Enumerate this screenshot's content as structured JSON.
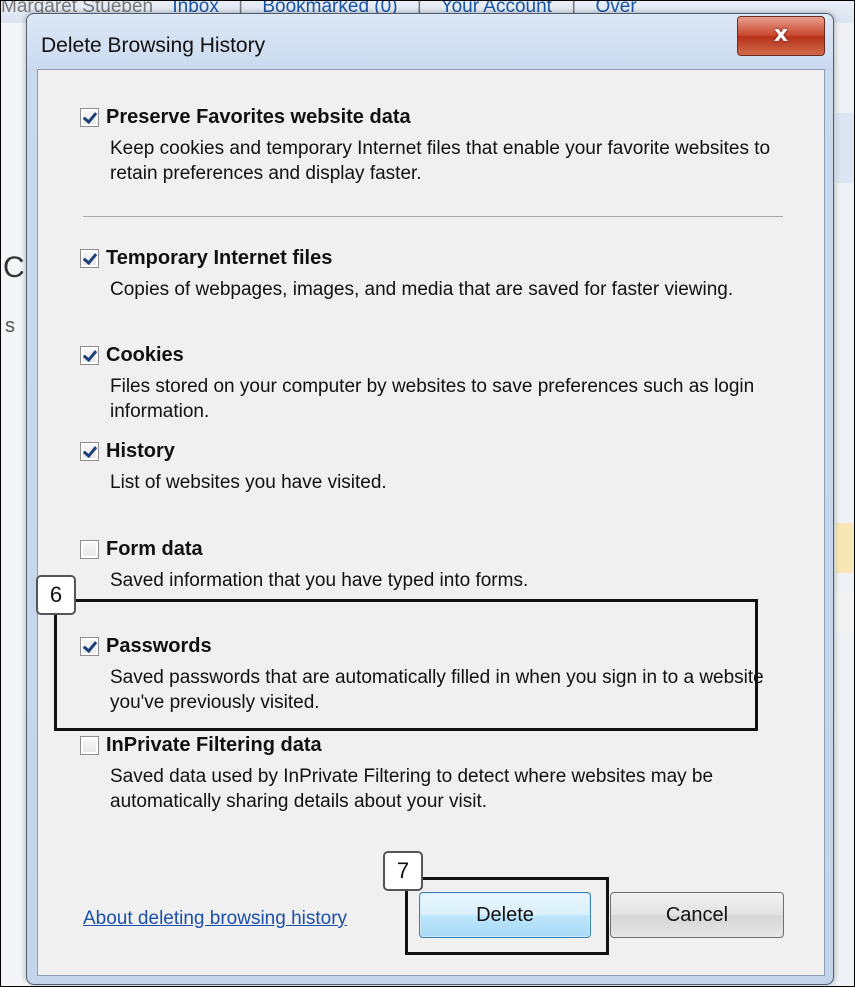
{
  "background": {
    "top_strip": [
      "Margaret Stueben",
      "Inbox",
      "|",
      "Bookmarked (0)",
      "|",
      "Your Account",
      "|",
      "Over"
    ]
  },
  "dialog": {
    "title": "Delete Browsing History",
    "close_glyph": "x"
  },
  "options": [
    {
      "label": "Preserve Favorites website data",
      "description": "Keep cookies and temporary Internet files that enable your favorite websites to retain preferences and display faster.",
      "checked": true
    },
    {
      "label": "Temporary Internet files",
      "description": "Copies of webpages, images, and media that are saved for faster viewing.",
      "checked": true
    },
    {
      "label": "Cookies",
      "description": "Files stored on your computer by websites to save preferences such as login information.",
      "checked": true
    },
    {
      "label": "History",
      "description": "List of websites you have visited.",
      "checked": true
    },
    {
      "label": "Form data",
      "description": "Saved information that you have typed into forms.",
      "checked": false
    },
    {
      "label": "Passwords",
      "description": "Saved passwords that are automatically filled in when you sign in to a website you've previously visited.",
      "checked": true
    },
    {
      "label": "InPrivate Filtering data",
      "description": "Saved data used by InPrivate Filtering to detect where websites may be automatically sharing details about your visit.",
      "checked": false
    }
  ],
  "callouts": {
    "passwords_step": "6",
    "delete_step": "7"
  },
  "footer": {
    "link": "About deleting browsing history",
    "delete_label": "Delete",
    "cancel_label": "Cancel"
  }
}
